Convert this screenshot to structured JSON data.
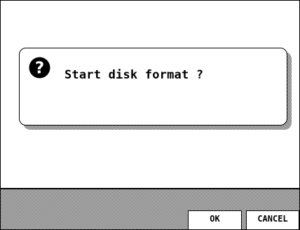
{
  "dialog": {
    "icon": "question-icon",
    "message": "Start disk format ?"
  },
  "buttons": {
    "ok_label": "OK",
    "cancel_label": "CANCEL"
  }
}
